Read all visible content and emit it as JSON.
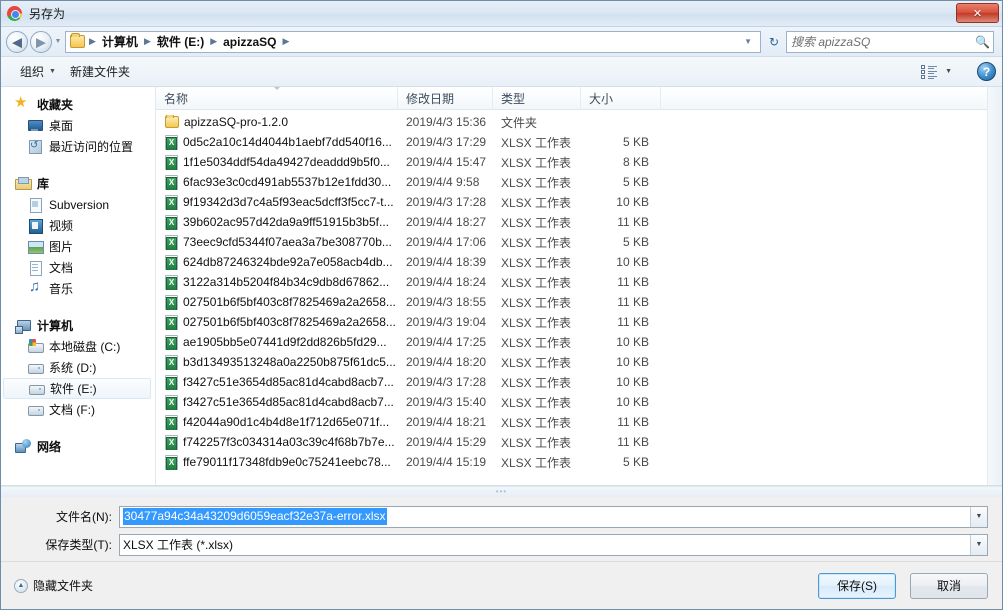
{
  "window": {
    "title": "另存为",
    "app_icon": "chrome-icon",
    "close_label": "✕"
  },
  "nav": {
    "back_glyph": "◀",
    "forward_glyph": "▶",
    "history_chevron": "▼",
    "refresh_glyph": "↻",
    "breadcrumbs": [
      "计算机",
      "软件 (E:)",
      "apizzaSQ"
    ],
    "separator": "▶",
    "dropdown_caret": "▼"
  },
  "search": {
    "placeholder": "搜索 apizzaSQ",
    "icon": "search-icon"
  },
  "toolbar": {
    "organize_label": "组织",
    "organize_caret": "▼",
    "new_folder_label": "新建文件夹",
    "view_caret": "▼",
    "help_label": "?"
  },
  "sidebar": {
    "groups": [
      {
        "header": {
          "label": "收藏夹",
          "icon": "star-icon"
        },
        "items": [
          {
            "label": "桌面",
            "icon": "desktop-icon"
          },
          {
            "label": "最近访问的位置",
            "icon": "recent-places-icon"
          }
        ]
      },
      {
        "header": {
          "label": "库",
          "icon": "library-icon"
        },
        "items": [
          {
            "label": "Subversion",
            "icon": "folder-doc-icon"
          },
          {
            "label": "视频",
            "icon": "video-icon"
          },
          {
            "label": "图片",
            "icon": "picture-icon"
          },
          {
            "label": "文档",
            "icon": "document-icon"
          },
          {
            "label": "音乐",
            "icon": "music-icon"
          }
        ]
      },
      {
        "header": {
          "label": "计算机",
          "icon": "computer-icon"
        },
        "items": [
          {
            "label": "本地磁盘 (C:)",
            "icon": "hard-disk-windows-icon",
            "selected": false
          },
          {
            "label": "系统 (D:)",
            "icon": "hard-disk-icon",
            "selected": false
          },
          {
            "label": "软件 (E:)",
            "icon": "hard-disk-icon",
            "selected": true
          },
          {
            "label": "文档 (F:)",
            "icon": "hard-disk-icon",
            "selected": false
          }
        ]
      },
      {
        "header": {
          "label": "网络",
          "icon": "network-icon"
        },
        "items": []
      }
    ]
  },
  "file_list": {
    "columns": [
      "名称",
      "修改日期",
      "类型",
      "大小"
    ],
    "sorted_column": "名称",
    "rows": [
      {
        "icon": "folder-icon",
        "name": "apizzaSQ-pro-1.2.0",
        "date": "2019/4/3 15:36",
        "type": "文件夹",
        "size": ""
      },
      {
        "icon": "xlsx-icon",
        "name": "0d5c2a10c14d4044b1aebf7dd540f16...",
        "date": "2019/4/3 17:29",
        "type": "XLSX 工作表",
        "size": "5 KB"
      },
      {
        "icon": "xlsx-icon",
        "name": "1f1e5034ddf54da49427deaddd9b5f0...",
        "date": "2019/4/4 15:47",
        "type": "XLSX 工作表",
        "size": "8 KB"
      },
      {
        "icon": "xlsx-icon",
        "name": "6fac93e3c0cd491ab5537b12e1fdd30...",
        "date": "2019/4/4 9:58",
        "type": "XLSX 工作表",
        "size": "5 KB"
      },
      {
        "icon": "xlsx-icon",
        "name": "9f19342d3d7c4a5f93eac5dcff3f5cc7-t...",
        "date": "2019/4/3 17:28",
        "type": "XLSX 工作表",
        "size": "10 KB"
      },
      {
        "icon": "xlsx-icon",
        "name": "39b602ac957d42da9a9ff51915b3b5f...",
        "date": "2019/4/4 18:27",
        "type": "XLSX 工作表",
        "size": "11 KB"
      },
      {
        "icon": "xlsx-icon",
        "name": "73eec9cfd5344f07aea3a7be308770b...",
        "date": "2019/4/4 17:06",
        "type": "XLSX 工作表",
        "size": "5 KB"
      },
      {
        "icon": "xlsx-icon",
        "name": "624db87246324bde92a7e058acb4db...",
        "date": "2019/4/4 18:39",
        "type": "XLSX 工作表",
        "size": "10 KB"
      },
      {
        "icon": "xlsx-icon",
        "name": "3122a314b5204f84b34c9db8d67862...",
        "date": "2019/4/4 18:24",
        "type": "XLSX 工作表",
        "size": "11 KB"
      },
      {
        "icon": "xlsx-icon",
        "name": "027501b6f5bf403c8f7825469a2a2658...",
        "date": "2019/4/3 18:55",
        "type": "XLSX 工作表",
        "size": "11 KB"
      },
      {
        "icon": "xlsx-icon",
        "name": "027501b6f5bf403c8f7825469a2a2658...",
        "date": "2019/4/3 19:04",
        "type": "XLSX 工作表",
        "size": "11 KB"
      },
      {
        "icon": "xlsx-icon",
        "name": "ae1905bb5e07441d9f2dd826b5fd29...",
        "date": "2019/4/4 17:25",
        "type": "XLSX 工作表",
        "size": "10 KB"
      },
      {
        "icon": "xlsx-icon",
        "name": "b3d13493513248a0a2250b875f61dc5...",
        "date": "2019/4/4 18:20",
        "type": "XLSX 工作表",
        "size": "10 KB"
      },
      {
        "icon": "xlsx-icon",
        "name": "f3427c51e3654d85ac81d4cabd8acb7...",
        "date": "2019/4/3 17:28",
        "type": "XLSX 工作表",
        "size": "10 KB"
      },
      {
        "icon": "xlsx-icon",
        "name": "f3427c51e3654d85ac81d4cabd8acb7...",
        "date": "2019/4/3 15:40",
        "type": "XLSX 工作表",
        "size": "10 KB"
      },
      {
        "icon": "xlsx-icon",
        "name": "f42044a90d1c4b4d8e1f712d65e071f...",
        "date": "2019/4/4 18:21",
        "type": "XLSX 工作表",
        "size": "11 KB"
      },
      {
        "icon": "xlsx-icon",
        "name": "f742257f3c034314a03c39c4f68b7b7e...",
        "date": "2019/4/4 15:29",
        "type": "XLSX 工作表",
        "size": "11 KB"
      },
      {
        "icon": "xlsx-icon",
        "name": "ffe79011f17348fdb9e0c75241eebc78...",
        "date": "2019/4/4 15:19",
        "type": "XLSX 工作表",
        "size": "5 KB"
      }
    ]
  },
  "form": {
    "filename_label": "文件名(N):",
    "filename_value": "30477a94c34a43209d6059eacf32e37a-error.xlsx",
    "filetype_label": "保存类型(T):",
    "filetype_value": "XLSX 工作表 (*.xlsx)",
    "combo_caret": "▼"
  },
  "footer": {
    "hide_folders_label": "隐藏文件夹",
    "hide_folders_glyph": "▲",
    "save_label": "保存(S)",
    "cancel_label": "取消"
  },
  "colors": {
    "selection_blue": "#3399ff",
    "accent_border": "#4a9bd4",
    "close_red": "#d8503a"
  }
}
